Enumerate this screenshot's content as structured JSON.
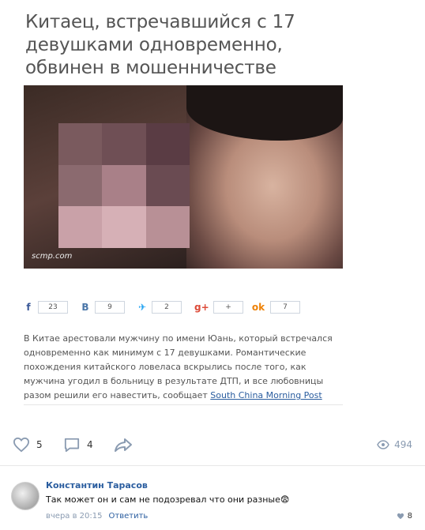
{
  "article": {
    "headline": "Китаец, встречавшийся с 17 девушками одновременно, обвинен в мошенничестве",
    "photo_caption": "scmp.com",
    "shares": [
      {
        "icon": "facebook-icon",
        "glyph": "f",
        "count": "23",
        "color": "#3b5998"
      },
      {
        "icon": "vk-icon",
        "glyph": "В",
        "count": "9",
        "color": "#4a76a8"
      },
      {
        "icon": "twitter-icon",
        "glyph": "✈",
        "count": "2",
        "color": "#1da1f2"
      },
      {
        "icon": "google-plus-icon",
        "glyph": "g+",
        "count": "+",
        "color": "#dd4b39"
      },
      {
        "icon": "odnoklassniki-icon",
        "glyph": "ok",
        "count": "7",
        "color": "#ee8208"
      }
    ],
    "body": "В Китае арестовали мужчину по имени Юань, который встречался одновременно как минимум с 17 девушками. Романтические похождения китайского ловеласа вскрылись после того, как мужчина угодил в больницу в результате ДТП, и все любовницы разом решили его навестить, сообщает",
    "source_link": "South China Morning Post"
  },
  "post_actions": {
    "likes": "5",
    "comments": "4",
    "views": "494"
  },
  "comment": {
    "author": "Константин Тарасов",
    "text": "Так может он и сам не подозревал что они разные",
    "emoji": "😨",
    "time": "вчера в 20:15",
    "reply_label": "Ответить",
    "likes": "8"
  },
  "colors": {
    "accent": "#2a5d9f",
    "muted": "#8a9bb1"
  }
}
